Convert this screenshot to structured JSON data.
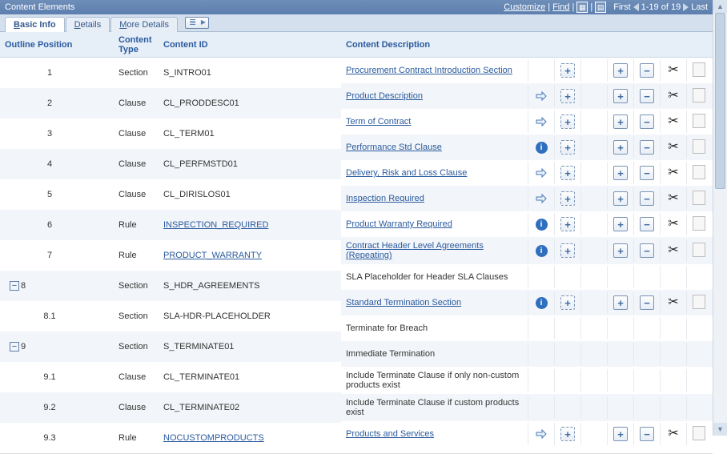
{
  "title": "Content Elements",
  "toolbar": {
    "customize": "Customize",
    "find": "Find",
    "first": "First",
    "range": "1-19 of 19",
    "last": "Last"
  },
  "tabs": [
    {
      "label_pre": "",
      "label_und": "B",
      "label_post": "asic Info",
      "active": true
    },
    {
      "label_pre": "",
      "label_und": "D",
      "label_post": "etails",
      "active": false
    },
    {
      "label_pre": "",
      "label_und": "M",
      "label_post": "ore Details",
      "active": false
    }
  ],
  "headers": {
    "outline": "Outline Position",
    "type": "Content Type",
    "id": "Content ID",
    "desc": "Content Description"
  },
  "left_rows": [
    {
      "outline": "1",
      "collapsible": false,
      "type": "Section",
      "id": "S_INTRO01",
      "link": false
    },
    {
      "outline": "2",
      "collapsible": false,
      "type": "Clause",
      "id": "CL_PRODDESC01",
      "link": false
    },
    {
      "outline": "3",
      "collapsible": false,
      "type": "Clause",
      "id": "CL_TERM01",
      "link": false
    },
    {
      "outline": "4",
      "collapsible": false,
      "type": "Clause",
      "id": "CL_PERFMSTD01",
      "link": false
    },
    {
      "outline": "5",
      "collapsible": false,
      "type": "Clause",
      "id": "CL_DIRISLOS01",
      "link": false
    },
    {
      "outline": "6",
      "collapsible": false,
      "type": "Rule",
      "id": "INSPECTION_REQUIRED",
      "link": true
    },
    {
      "outline": "7",
      "collapsible": false,
      "type": "Rule",
      "id": "PRODUCT_WARRANTY",
      "link": true
    },
    {
      "outline": "8",
      "collapsible": true,
      "type": "Section",
      "id": "S_HDR_AGREEMENTS",
      "link": false
    },
    {
      "outline": "8.1",
      "collapsible": false,
      "type": "Section",
      "id": "SLA-HDR-PLACEHOLDER",
      "link": false
    },
    {
      "outline": "9",
      "collapsible": true,
      "type": "Section",
      "id": "S_TERMINATE01",
      "link": false
    },
    {
      "outline": "9.1",
      "collapsible": false,
      "type": "Clause",
      "id": "CL_TERMINATE01",
      "link": false
    },
    {
      "outline": "9.2",
      "collapsible": false,
      "type": "Clause",
      "id": "CL_TERMINATE02",
      "link": false
    },
    {
      "outline": "9.3",
      "collapsible": false,
      "type": "Rule",
      "id": "NOCUSTOMPRODUCTS",
      "link": true
    }
  ],
  "right_rows": [
    {
      "desc": "Procurement Contract Introduction Section",
      "link": true,
      "col1": "",
      "boxes": true
    },
    {
      "desc": "Product Description",
      "link": true,
      "col1": "arrow",
      "boxes": true
    },
    {
      "desc": "Term of Contract",
      "link": true,
      "col1": "arrow",
      "boxes": true
    },
    {
      "desc": "Performance Std Clause",
      "link": true,
      "col1": "info",
      "boxes": true
    },
    {
      "desc": "Delivery, Risk and Loss Clause",
      "link": true,
      "col1": "arrow",
      "boxes": true
    },
    {
      "desc": "Inspection Required",
      "link": true,
      "col1": "arrow",
      "boxes": true
    },
    {
      "desc": "Product Warranty Required",
      "link": true,
      "col1": "info",
      "boxes": true
    },
    {
      "desc": "Contract Header Level Agreements (Repeating)",
      "link": true,
      "col1": "info",
      "boxes": true,
      "tall": true
    },
    {
      "desc": "SLA Placeholder for Header SLA Clauses",
      "link": false,
      "col1": "",
      "boxes": false
    },
    {
      "desc": "Standard Termination Section",
      "link": true,
      "col1": "info",
      "boxes": true
    },
    {
      "desc": "Terminate for Breach",
      "link": false,
      "col1": "",
      "boxes": false
    },
    {
      "desc": "Immediate Termination",
      "link": false,
      "col1": "",
      "boxes": false
    },
    {
      "desc": "Include Terminate Clause if only non-custom products exist",
      "link": false,
      "col1": "",
      "boxes": false,
      "tall": true
    },
    {
      "desc": "Include Terminate Clause if custom products exist",
      "link": false,
      "col1": "",
      "boxes": false,
      "tall": true
    },
    {
      "desc": "Products and Services",
      "link": true,
      "col1": "arrow",
      "boxes": true
    }
  ]
}
